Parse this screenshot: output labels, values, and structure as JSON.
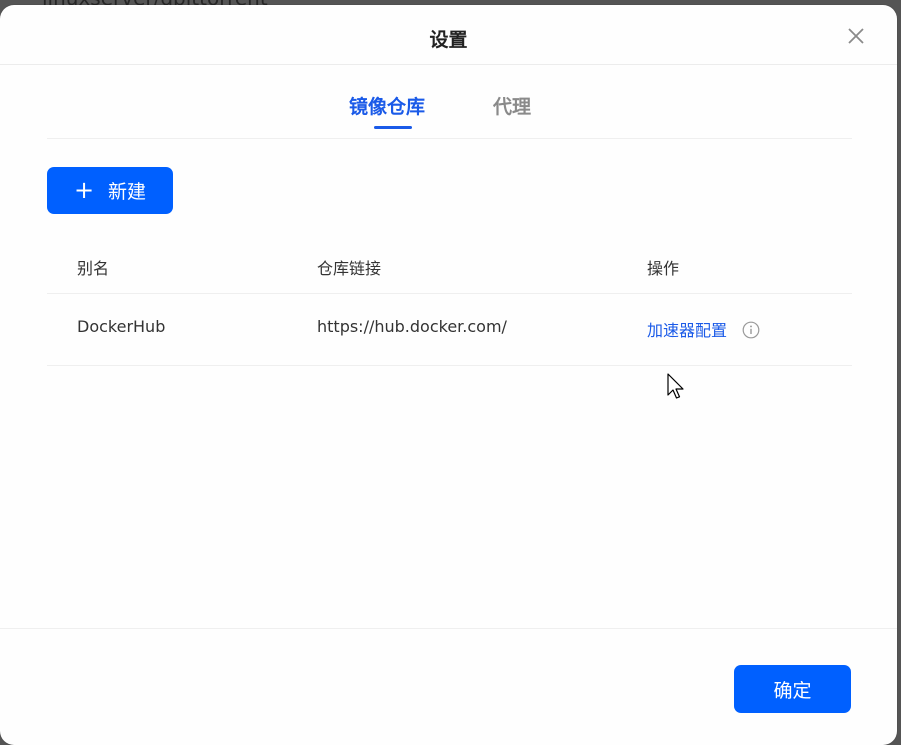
{
  "backdrop": {
    "text": "linuxserver/qbittorrent"
  },
  "dialog": {
    "title": "设置",
    "close_icon": "close-icon"
  },
  "tabs": [
    {
      "label": "镜像仓库",
      "active": true
    },
    {
      "label": "代理",
      "active": false
    }
  ],
  "toolbar": {
    "new_label": "新建",
    "new_icon": "plus-icon"
  },
  "table": {
    "headers": [
      "别名",
      "仓库链接",
      "操作"
    ],
    "rows": [
      {
        "alias": "DockerHub",
        "url": "https://hub.docker.com/",
        "action_label": "加速器配置",
        "action_icon": "info-icon"
      }
    ]
  },
  "footer": {
    "confirm_label": "确定"
  },
  "colors": {
    "accent": "#0060ff",
    "tab_active": "#1a5ae8",
    "tab_inactive": "#8a8a8a"
  }
}
